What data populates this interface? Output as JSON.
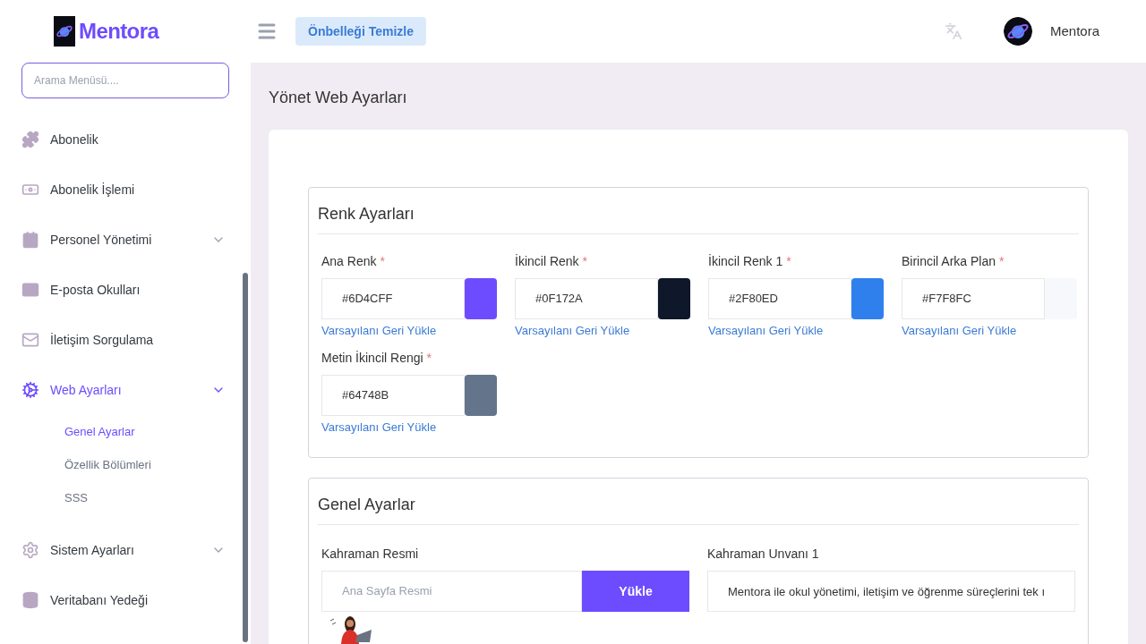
{
  "brand": {
    "name": "Mentora"
  },
  "header": {
    "clear_cache_button": "Önbelleği Temizle",
    "user_name": "Mentora"
  },
  "sidebar": {
    "search": {
      "placeholder": "Arama Menüsü...."
    },
    "items": [
      {
        "label": "Abonelik",
        "selected": false
      },
      {
        "label": "Abonelik İşlemi",
        "selected": false
      },
      {
        "label": "Personel Yönetimi",
        "selected": false,
        "has_submenu": true
      },
      {
        "label": "E-posta Okulları",
        "selected": false
      },
      {
        "label": "İletişim Sorgulama",
        "selected": false
      },
      {
        "label": "Web Ayarları",
        "selected": true,
        "has_submenu": true,
        "children": [
          {
            "label": "Genel Ayarlar",
            "selected": true
          },
          {
            "label": "Özellik Bölümleri",
            "selected": false
          },
          {
            "label": "SSS",
            "selected": false
          }
        ]
      },
      {
        "label": "Sistem Ayarları",
        "selected": false,
        "has_submenu": true
      },
      {
        "label": "Veritabanı Yedeği",
        "selected": false
      }
    ]
  },
  "page_title": "Yönet Web Ayarları",
  "color_settings": {
    "title": "Renk Ayarları",
    "fields": [
      {
        "label": "Ana Renk",
        "mark": "*",
        "value": "#6D4CFF",
        "color": "#6d4cff",
        "restore_link": "Varsayılanı Geri Yükle"
      },
      {
        "label": "İkincil Renk",
        "mark": "*",
        "value": "#0F172A",
        "color": "#0f172a",
        "restore_link": "Varsayılanı Geri Yükle"
      },
      {
        "label": "İkincil Renk 1",
        "mark": "*",
        "value": "#2F80ED",
        "color": "#2f80ed",
        "restore_link": "Varsayılanı Geri Yükle"
      },
      {
        "label": "Birincil Arka Plan",
        "mark": "*",
        "value": "#F7F8FC",
        "color": "#f7f8fc",
        "restore_link": "Varsayılanı Geri Yükle"
      },
      {
        "label": "Metin İkincil Rengi",
        "mark": "*",
        "value": "#64748B",
        "color": "#64748b",
        "restore_link": "Varsayılanı Geri Yükle"
      }
    ]
  },
  "general_settings": {
    "title": "Genel Ayarlar",
    "hero_image": {
      "label": "Kahraman Resmi",
      "placeholder": "Ana Sayfa Resmi",
      "upload_button": "Yükle"
    },
    "hero_title": {
      "label": "Kahraman Unvanı 1",
      "value": "Mentora ile okul yönetimi, iletişim ve öğrenme süreçlerini tek ı"
    }
  }
}
